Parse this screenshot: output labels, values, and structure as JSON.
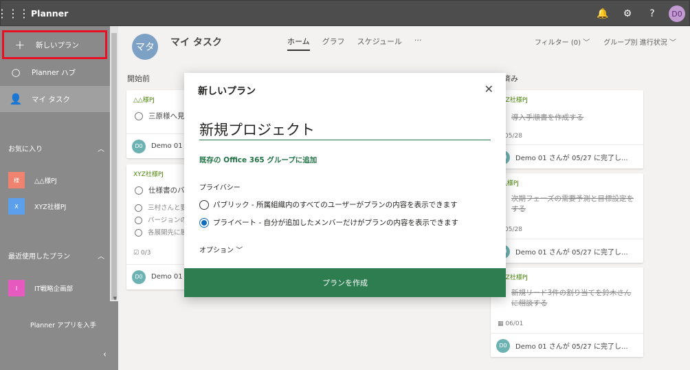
{
  "topbar": {
    "title": "Planner",
    "avatar": "D0"
  },
  "sidebar": {
    "new_plan": "新しいプラン",
    "hub": "Planner ハブ",
    "my_tasks": "マイ タスク",
    "favorites_label": "お気に入り",
    "favorites": [
      {
        "badge": "様",
        "name": "△△様PJ",
        "color": "#f0836f"
      },
      {
        "badge": "X",
        "name": "XYZ社様PJ",
        "color": "#5aa0ea"
      }
    ],
    "recent_label": "最近使用したプラン",
    "recent": [
      {
        "badge": "I",
        "name": "IT戦略企画部",
        "color": "#e65ac0"
      }
    ],
    "get_app": "Planner アプリを入手"
  },
  "main": {
    "avatar": "マタ",
    "title": "マイ タスク",
    "tabs": [
      "ホーム",
      "グラフ",
      "スケジュール",
      "···"
    ],
    "filter": "フィルター (0)",
    "group": "グループ別 進行状況",
    "col_left": "開始前",
    "col_right": "済み",
    "left_cards": [
      {
        "label": "△△様PJ",
        "task": "三原様へ見",
        "foot": "Demo 01"
      },
      {
        "label": "XYZ社様PJ",
        "task": "仕様書のバ",
        "subs": [
          "三村さんと要",
          "バージョンの",
          "各展開先に展"
        ],
        "progress": "0/3",
        "foot": "Demo 01"
      }
    ],
    "right_cards": [
      {
        "label": "XYZ社様PJ",
        "task": "導入手順書を作成する",
        "date": "05/28",
        "foot": "Demo 01 さんが 05/27 に完了し..."
      },
      {
        "label": "△△様PJ",
        "task": "次期フェーズの需要予測と目標設定をする",
        "date": "05/28",
        "foot": "Demo 01 さんが 05/27 に完了し..."
      },
      {
        "label": "XYZ社様PJ",
        "task": "新規リード3件の割り当てを鈴木さんに相談する",
        "date": "06/01",
        "foot": "Demo 01 さんが 05/27 に完了し..."
      }
    ]
  },
  "dialog": {
    "title": "新しいプラン",
    "name_value": "新規プロジェクト",
    "add_group": "既存の Office 365 グループに追加",
    "privacy_label": "プライバシー",
    "public": "パブリック - 所属組織内のすべてのユーザーがプランの内容を表示できます",
    "private": "プライベート - 自分が追加したメンバーだけがプランの内容を表示できます",
    "options": "オプション",
    "create": "プランを作成"
  }
}
